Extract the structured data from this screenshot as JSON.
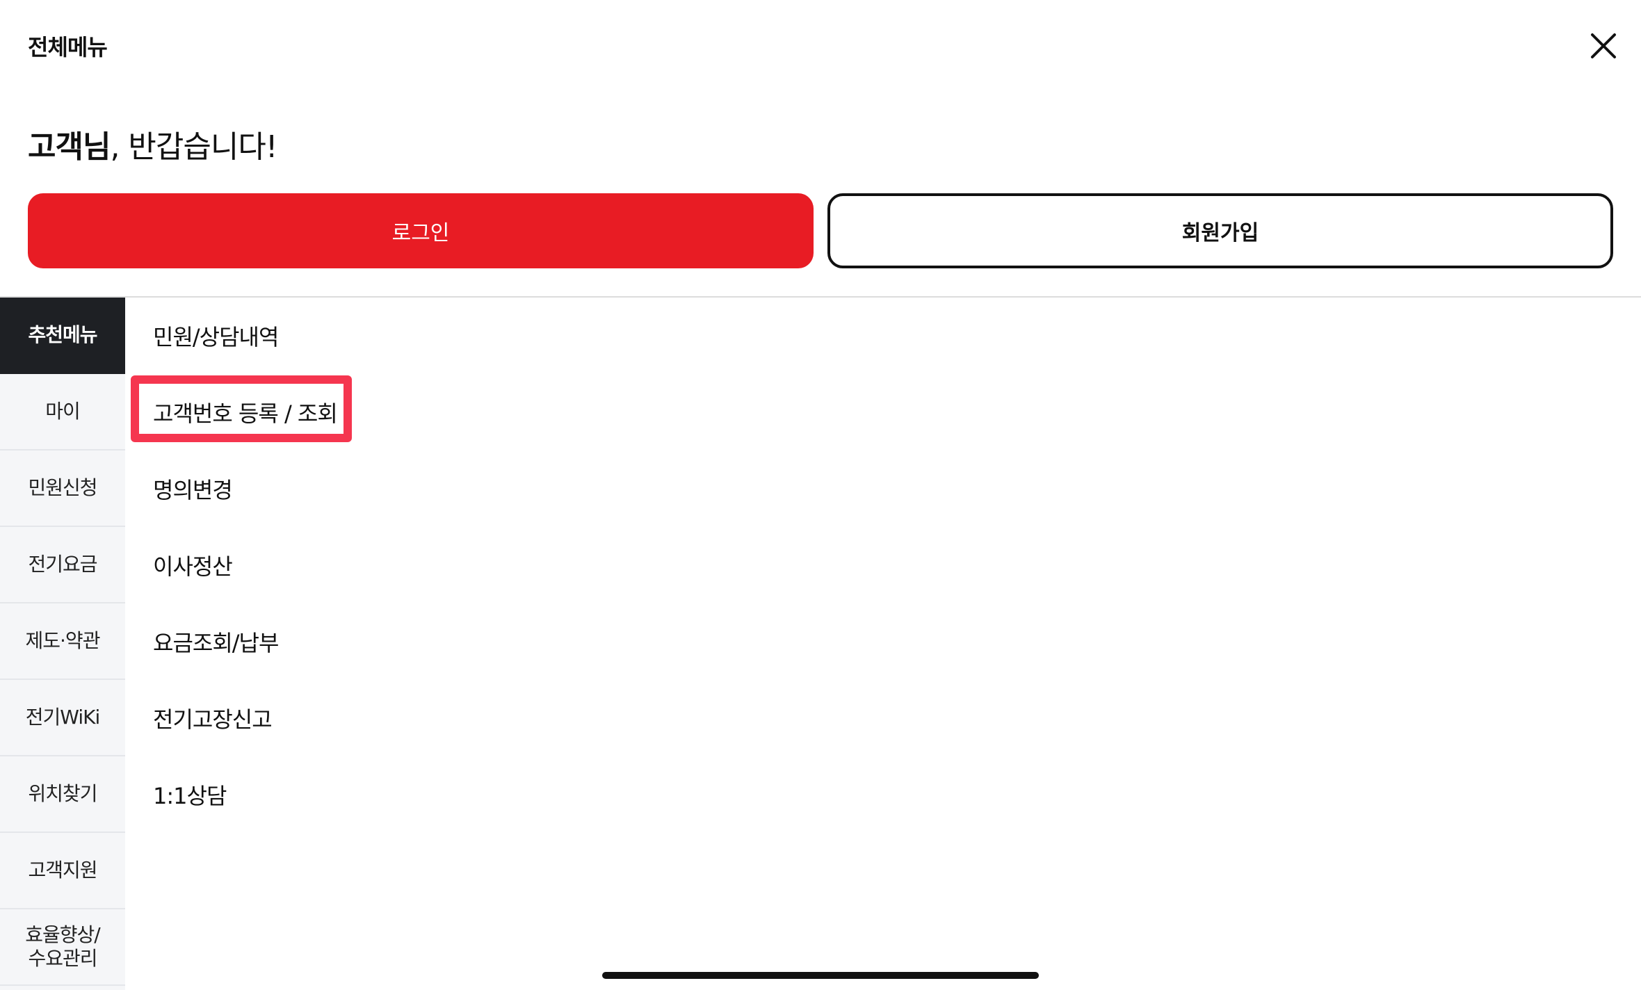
{
  "header": {
    "title": "전체메뉴",
    "close_icon": "close-icon"
  },
  "greeting": {
    "name": "고객님",
    "message": ", 반갑습니다!"
  },
  "auth": {
    "login_label": "로그인",
    "join_label": "회원가입"
  },
  "colors": {
    "brand_red": "#e81c24",
    "highlight": "#f5364f",
    "sidebar_active": "#1e2024",
    "sidebar_bg": "#f5f6f8"
  },
  "sidebar": {
    "items": [
      {
        "label": "추천메뉴",
        "active": true
      },
      {
        "label": "마이",
        "active": false
      },
      {
        "label": "민원신청",
        "active": false
      },
      {
        "label": "전기요금",
        "active": false
      },
      {
        "label": "제도·약관",
        "active": false
      },
      {
        "label": "전기WiKi",
        "active": false
      },
      {
        "label": "위치찾기",
        "active": false
      },
      {
        "label": "고객지원",
        "active": false
      },
      {
        "label": "효율향상/\n수요관리",
        "active": false
      }
    ]
  },
  "menu": {
    "items": [
      {
        "label": "민원/상담내역",
        "highlighted": false
      },
      {
        "label": "고객번호 등록 / 조회",
        "highlighted": true
      },
      {
        "label": "명의변경",
        "highlighted": false
      },
      {
        "label": "이사정산",
        "highlighted": false
      },
      {
        "label": "요금조회/납부",
        "highlighted": false
      },
      {
        "label": "전기고장신고",
        "highlighted": false
      },
      {
        "label": "1:1상담",
        "highlighted": false
      }
    ]
  }
}
